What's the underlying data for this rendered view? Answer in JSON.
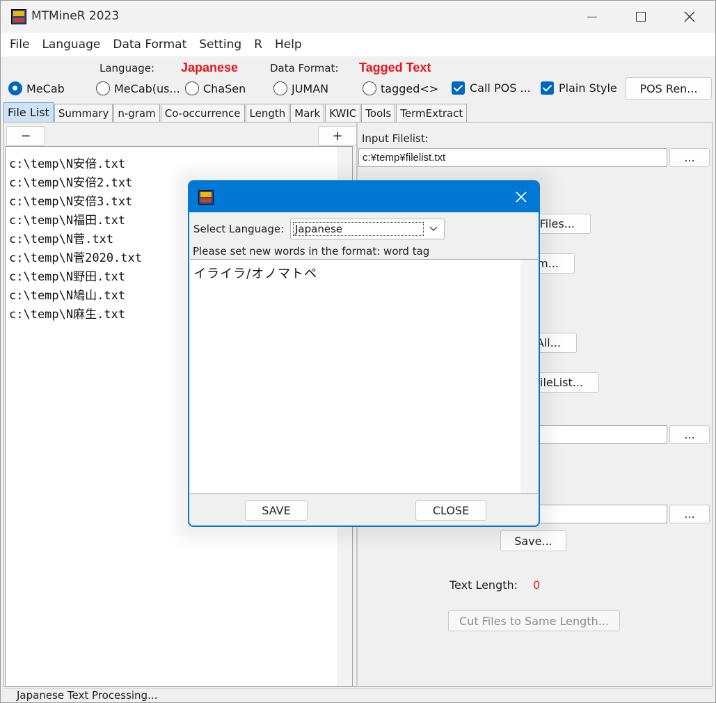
{
  "window": {
    "title": "MTMineR 2023"
  },
  "menu": [
    "File",
    "Language",
    "Data Format",
    "Setting",
    "R",
    "Help"
  ],
  "settings": {
    "language_label": "Language:",
    "language_value": "Japanese",
    "data_format_label": "Data Format:",
    "data_format_value": "Tagged Text",
    "radios": [
      {
        "label": "MeCab",
        "checked": true
      },
      {
        "label": "MeCab(us...",
        "checked": false
      },
      {
        "label": "ChaSen",
        "checked": false
      },
      {
        "label": "JUMAN",
        "checked": false
      },
      {
        "label": "tagged<>",
        "checked": false
      }
    ],
    "checks": [
      {
        "label": "Call POS ...",
        "checked": true
      },
      {
        "label": "Plain Style",
        "checked": true
      }
    ],
    "pos_rename_button": "POS Ren..."
  },
  "tabs": [
    "File List",
    "Summary",
    "n-gram",
    "Co-occurrence",
    "Length",
    "Mark",
    "KWIC",
    "Tools",
    "TermExtract"
  ],
  "filelist": {
    "remove_button": "−",
    "add_button": "+",
    "files": [
      "c:\\temp\\N安倍.txt",
      "c:\\temp\\N安倍2.txt",
      "c:\\temp\\N安倍3.txt",
      "c:\\temp\\N福田.txt",
      "c:\\temp\\N菅.txt",
      "c:\\temp\\N菅2020.txt",
      "c:\\temp\\N野田.txt",
      "c:\\temp\\N鳩山.txt",
      "c:\\temp\\N麻生.txt"
    ]
  },
  "right_pane": {
    "input_filelist_label": "Input Filelist:",
    "input_filelist_value": "c:¥temp¥filelist.txt",
    "browse_label": "...",
    "files_button": "Files...",
    "term_button": "rm...",
    "all_button": "All...",
    "filelist_button": "FileList...",
    "save_button": "Save...",
    "text_length_label": "Text Length:",
    "text_length_value": "0",
    "cut_files_button": "Cut Files to Same Length..."
  },
  "status": {
    "text": "Japanese Text Processing..."
  },
  "dialog": {
    "select_language_label": "Select Language:",
    "language_value": "Japanese",
    "instruction": "Please set new words in the format: word tag",
    "content": "イライラ/オノマトペ",
    "save_button": "SAVE",
    "close_button": "CLOSE"
  },
  "colors": {
    "accent": "#0078d4",
    "highlight_red": "#e8141c",
    "active_tab": "#cfe3f7"
  }
}
